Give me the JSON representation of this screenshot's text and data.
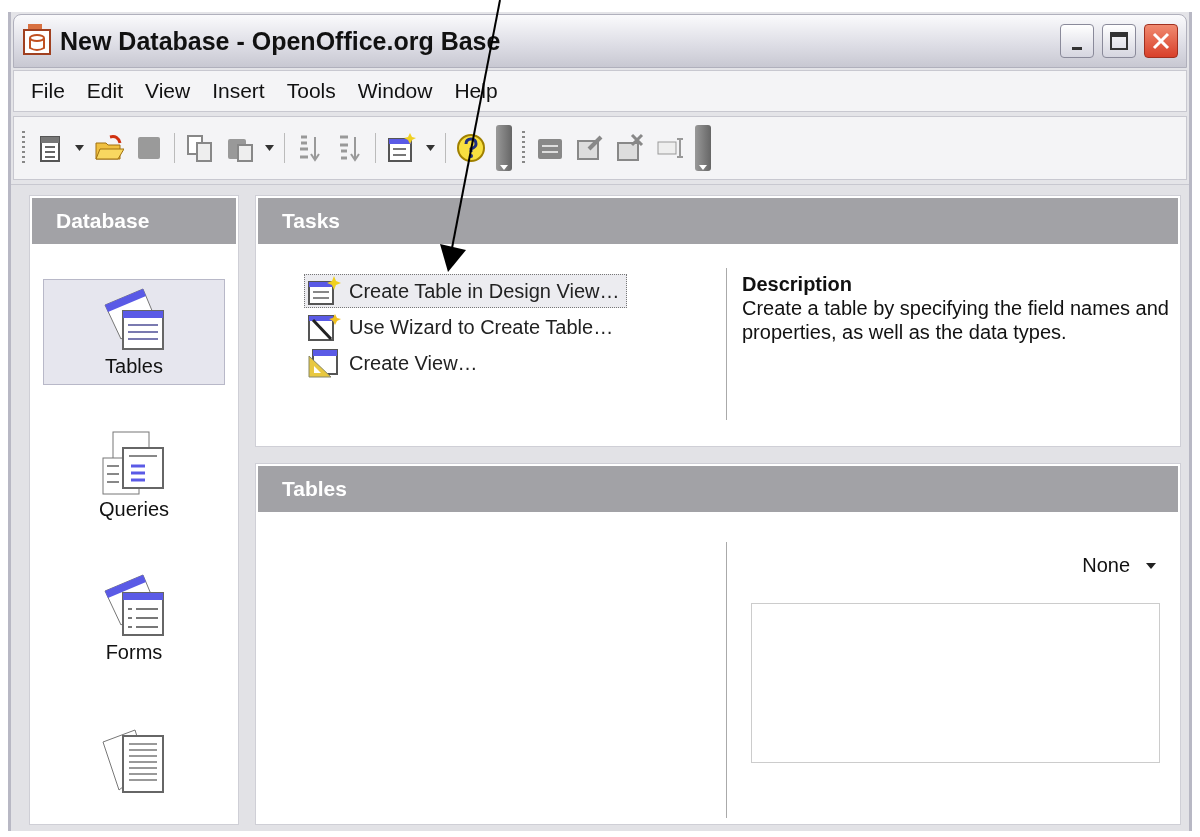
{
  "window": {
    "title": "New Database - OpenOffice.org Base"
  },
  "menu": [
    {
      "label": "File"
    },
    {
      "label": "Edit"
    },
    {
      "label": "View"
    },
    {
      "label": "Insert"
    },
    {
      "label": "Tools"
    },
    {
      "label": "Window"
    },
    {
      "label": "Help"
    }
  ],
  "sidebar": {
    "title": "Database",
    "items": [
      {
        "label": "Tables",
        "selected": true,
        "kind": "tables"
      },
      {
        "label": "Queries",
        "selected": false,
        "kind": "queries"
      },
      {
        "label": "Forms",
        "selected": false,
        "kind": "forms"
      },
      {
        "selected": false,
        "kind": "reports"
      }
    ]
  },
  "tasks": {
    "title": "Tasks",
    "items": [
      {
        "label": "Create Table in Design View…",
        "selected": true,
        "kind": "design"
      },
      {
        "label": "Use Wizard to Create Table…",
        "selected": false,
        "kind": "wizard"
      },
      {
        "label": "Create View…",
        "selected": false,
        "kind": "view"
      }
    ],
    "description": {
      "title": "Description",
      "text": "Create a table by specifying the field names and properties, as well as the data types."
    }
  },
  "tables": {
    "title": "Tables",
    "preview": {
      "value": "None"
    }
  }
}
